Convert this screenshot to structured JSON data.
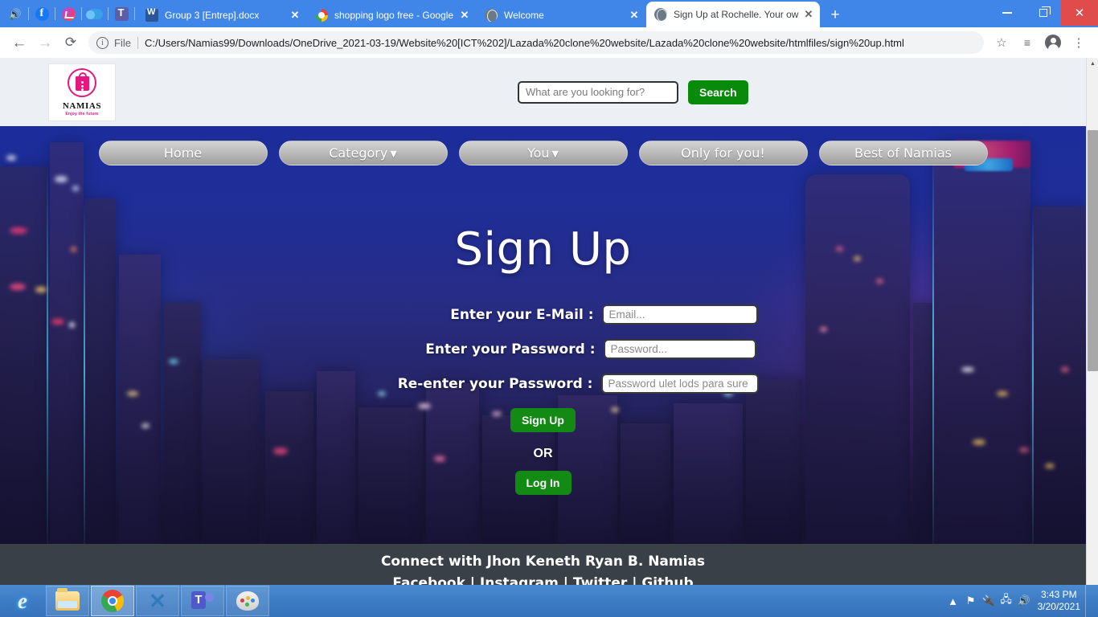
{
  "browser": {
    "pinned_icons": [
      "speaker-icon",
      "facebook-icon",
      "messenger-icon",
      "onedrive-icon",
      "teams-icon"
    ],
    "tabs": [
      {
        "title": "Group 3 [Entrep].docx",
        "favicon": "word-icon",
        "active": false,
        "close_label": "✕"
      },
      {
        "title": "shopping logo free - Google Sea",
        "favicon": "google-icon",
        "active": false,
        "close_label": "✕"
      },
      {
        "title": "Welcome",
        "favicon": "globe-icon",
        "active": false,
        "close_label": "✕"
      },
      {
        "title": "Sign Up at Rochelle. Your own sh",
        "favicon": "globe-icon",
        "active": true,
        "close_label": "✕"
      }
    ],
    "new_tab_label": "+",
    "window_controls": {
      "minimize": "minimize-icon",
      "maximize": "maximize-icon",
      "close": "✕"
    },
    "toolbar": {
      "back_label": "←",
      "forward_label": "→",
      "reload_label": "⟳",
      "info_label": "i",
      "scheme_label": "File",
      "url": "C:/Users/Namias99/Downloads/OneDrive_2021-03-19/Website%20[ICT%202]/Lazada%20clone%20website/Lazada%20clone%20website/htmlfiles/sign%20up.html",
      "star_label": "☆",
      "reading_list_label": "≡",
      "profile_label": "profile-avatar-icon",
      "menu_label": "⋮"
    }
  },
  "site": {
    "logo": {
      "name": "NAMIAS",
      "tagline": "Enjoy the future"
    },
    "search": {
      "placeholder": "What are you looking for?",
      "value": "",
      "button_label": "Search"
    },
    "nav": [
      {
        "label": "Home",
        "has_dropdown": false
      },
      {
        "label": "Category",
        "has_dropdown": true
      },
      {
        "label": "You",
        "has_dropdown": true
      },
      {
        "label": "Only for you!",
        "has_dropdown": false
      },
      {
        "label": "Best of Namias",
        "has_dropdown": false
      }
    ],
    "signup": {
      "title": "Sign Up",
      "email_label": "Enter your E-Mail :",
      "email_placeholder": "Email...",
      "email_value": "",
      "password_label": "Enter your Password :",
      "password_placeholder": "Password...",
      "password_value": "",
      "repassword_label": "Re-enter your Password :",
      "repassword_placeholder": "Password ulet lods para sure",
      "repassword_value": "",
      "signup_button": "Sign Up",
      "or_text": "OR",
      "login_button": "Log In"
    },
    "footer": {
      "line1": "Connect with Jhon Keneth Ryan B. Namias",
      "line2": "Facebook | Instagram | Twitter | Github"
    },
    "scrollbar": {
      "up_label": "▲",
      "down_label": "▼"
    }
  },
  "taskbar": {
    "items": [
      {
        "icon": "internet-explorer-icon",
        "state": "plain"
      },
      {
        "icon": "file-explorer-icon",
        "state": "boxed"
      },
      {
        "icon": "chrome-icon",
        "state": "current"
      },
      {
        "icon": "vscode-icon",
        "state": "boxed"
      },
      {
        "icon": "teams-icon",
        "state": "boxed"
      },
      {
        "icon": "paint-icon",
        "state": "boxed"
      }
    ],
    "tray": {
      "overflow_label": "▲",
      "icons": [
        "flag-error-icon",
        "power-error-icon",
        "network-icon",
        "volume-icon"
      ],
      "time": "3:43 PM",
      "date": "3/20/2021"
    }
  },
  "colors": {
    "chrome_blue": "#3f86e8",
    "green_button": "#138a13",
    "search_green": "#0a8a0a",
    "logo_pink": "#e8167f",
    "footer_gray": "#3a4048",
    "taskbar_blue": "#3d7cc4"
  }
}
